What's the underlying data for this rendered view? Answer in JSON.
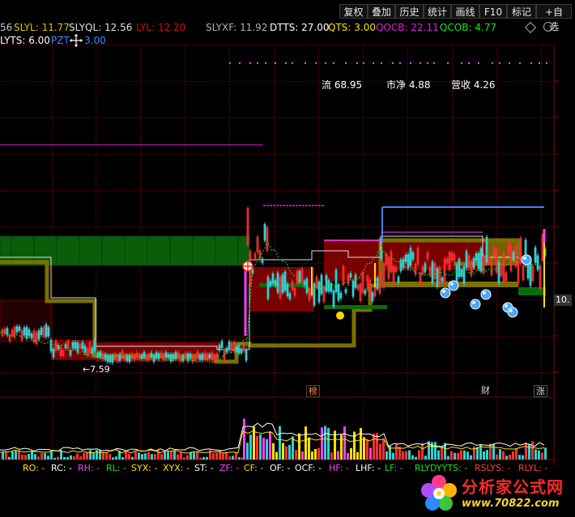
{
  "toolbar": {
    "buttons": [
      "复权",
      "叠加",
      "历史",
      "统计",
      "画线",
      "F10",
      "标记",
      "+自选"
    ]
  },
  "indicator_line1": [
    {
      "label": "56",
      "color": "#c8c8c8"
    },
    {
      "label": "SLYL: 11.77",
      "color": "#d8c800"
    },
    {
      "label": "SLYQL: 12.56",
      "color": "#e0e0e0"
    },
    {
      "label": "LYL: 12.20",
      "color": "#d01010"
    },
    {
      "label": "SLYXF: 11.92",
      "color": "#b0b0b0"
    },
    {
      "label": "DTTS: 27.00",
      "color": "#ffffff"
    },
    {
      "label": "QTS: 3.00",
      "color": "#ffe000"
    },
    {
      "label": "QOCB: 22.11",
      "color": "#e020e0"
    },
    {
      "label": "QCOB: 4.77",
      "color": "#20e020"
    }
  ],
  "indicator_line2": [
    {
      "label": "LYTS: 6.00",
      "color": "#ffffff"
    },
    {
      "label": "PZT",
      "color": "#3a8cff"
    },
    {
      "label": "3.00",
      "color": "#3a8cff"
    }
  ],
  "stats": {
    "liu": "流 68.95",
    "shijing": "市净 4.88",
    "yingshou": "营收 4.26"
  },
  "price_low_label": "7.59",
  "right_price_tag": "10.",
  "markers": {
    "bang": "榜",
    "cai": "财",
    "zhang": "涨"
  },
  "legend": [
    {
      "label": "RO: -",
      "color": "#ffe000"
    },
    {
      "label": "RC: -",
      "color": "#ffffff"
    },
    {
      "label": "RH: -",
      "color": "#ff40ff"
    },
    {
      "label": "RL: -",
      "color": "#20e020"
    },
    {
      "label": "SYX: -",
      "color": "#ffe000"
    },
    {
      "label": "XYX: -",
      "color": "#ffe000"
    },
    {
      "label": "ST: -",
      "color": "#ffffff"
    },
    {
      "label": "ZF: -",
      "color": "#ff40ff"
    },
    {
      "label": "CF: -",
      "color": "#ffe000"
    },
    {
      "label": "OF: -",
      "color": "#ffffff"
    },
    {
      "label": "OCF: -",
      "color": "#ffffff"
    },
    {
      "label": "HF: -",
      "color": "#ff40ff"
    },
    {
      "label": "LHF: -",
      "color": "#ffffff"
    },
    {
      "label": "LF: -",
      "color": "#20e020"
    },
    {
      "label": "RLYDYYTS: -",
      "color": "#20e020"
    },
    {
      "label": "RSLYS: -",
      "color": "#ff4040"
    },
    {
      "label": "RLYL: -",
      "color": "#ff4040"
    }
  ],
  "watermark": {
    "title": "分析家公式网",
    "url": "www.70822.com"
  },
  "icons": {
    "cursor": "move-cursor-icon",
    "diamond": "diamond-icon",
    "settings": "settings-circle-icon",
    "event": "event-crosshair-icon",
    "watermark_logo": "flower-logo-icon"
  },
  "colors": {
    "background": "#000000",
    "grid": "#6a0000",
    "band_green": "#0a5e0a",
    "band_red": "#7a0000",
    "olive_line": "#7a7000",
    "volume_red": "#ff2020",
    "volume_cyan": "#20e0e0"
  }
}
